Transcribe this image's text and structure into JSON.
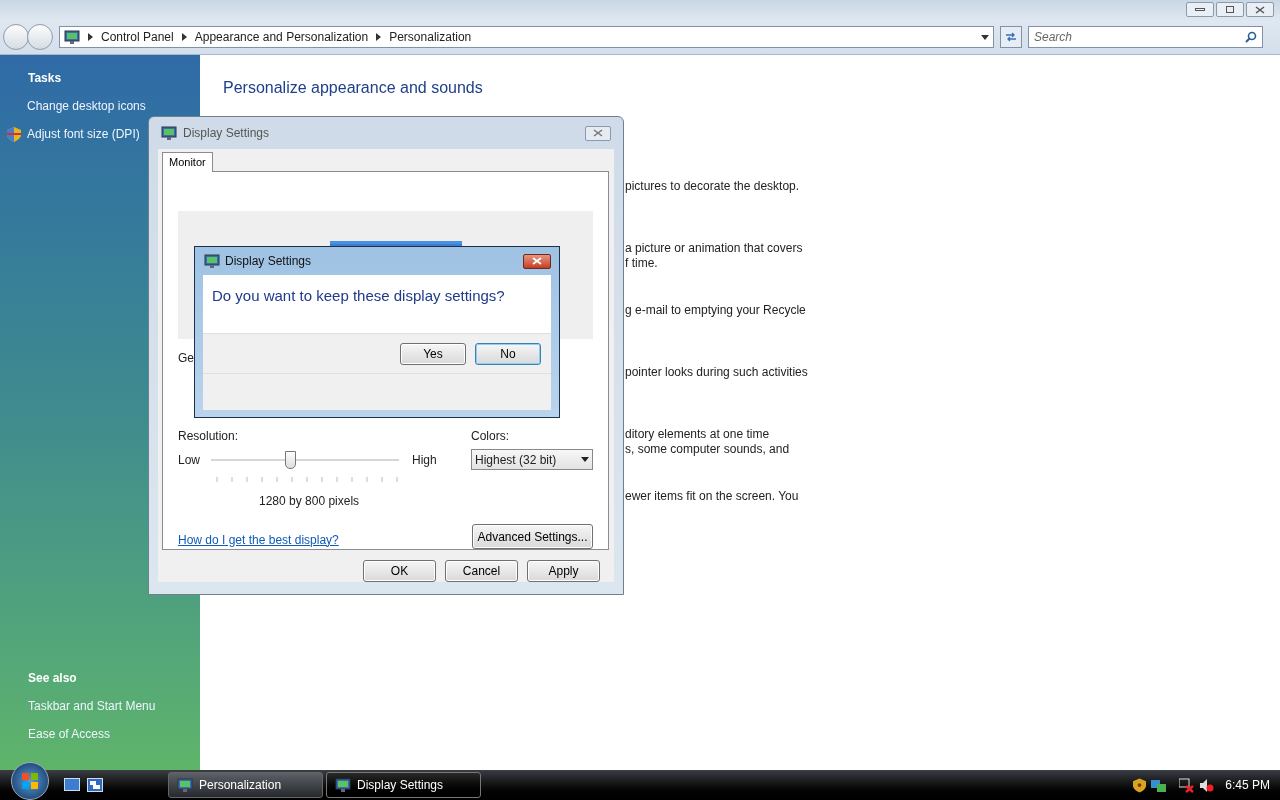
{
  "address_bar": {
    "crumbs": [
      "Control Panel",
      "Appearance and Personalization",
      "Personalization"
    ],
    "search_placeholder": "Search"
  },
  "sidebar": {
    "tasks_title": "Tasks",
    "tasks": [
      {
        "label": "Change desktop icons",
        "shield": false
      },
      {
        "label": "Adjust font size (DPI)",
        "shield": true
      }
    ],
    "see_also_title": "See also",
    "see_also": [
      "Taskbar and Start Menu",
      "Ease of Access"
    ]
  },
  "main": {
    "heading": "Personalize appearance and sounds",
    "fragments": [
      [
        "pictures to decorate the desktop."
      ],
      [
        "a picture or animation that covers",
        "f time."
      ],
      [
        "g e-mail to emptying your Recycle"
      ],
      [
        "pointer looks during such activities"
      ],
      [
        "ditory elements at one time",
        "s, some computer sounds, and"
      ],
      [
        "ewer items fit on the screen. You"
      ]
    ]
  },
  "display_settings": {
    "title": "Display Settings",
    "tabs": [
      {
        "label": "Monitor",
        "selected": true
      }
    ],
    "covered_label": "Ge",
    "resolution_label": "Resolution:",
    "low": "Low",
    "high": "High",
    "resolution": {
      "level": 0.42
    },
    "resolution_text": "1280 by 800 pixels",
    "colors_label": "Colors:",
    "colors_value": "Highest (32 bit)",
    "help_link": "How do I get the best display?",
    "advanced_button": "Advanced Settings...",
    "buttons": [
      "OK",
      "Cancel",
      "Apply"
    ]
  },
  "confirm": {
    "title": "Display Settings",
    "question": "Do you want to keep these display settings?",
    "buttons": [
      {
        "label": "Yes",
        "default": false
      },
      {
        "label": "No",
        "default": true
      }
    ]
  },
  "taskbar": {
    "tasks": [
      {
        "label": "Personalization",
        "selected": false
      },
      {
        "label": "Display Settings",
        "selected": true
      }
    ],
    "clock": "6:45 PM"
  }
}
